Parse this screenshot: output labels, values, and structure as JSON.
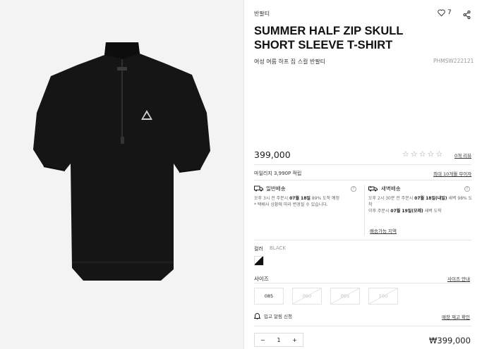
{
  "product": {
    "category": "반팔티",
    "like_count": "7",
    "title_line1": "SUMMER HALF ZIP SKULL",
    "title_line2": "SHORT SLEEVE T-SHIRT",
    "korean_name": "여성 여름 하프 집 스컬 반팔티",
    "code": "PHMSW222121",
    "price": "399,000",
    "reviews_link": "0개 리뷰",
    "rating_stars": 0
  },
  "mileage": {
    "text": "마일리지 3,990P 적립",
    "link": "최대 10개월 무이자"
  },
  "shipping": {
    "standard": {
      "label": "일반배송",
      "line1_pre": "오후 3시 전 주문시 ",
      "line1_date": "07월 18일",
      "line1_post": " 89% 도착 예정",
      "line2": "* 택배사 상황에 따라 변경될 수 있습니다."
    },
    "dawn": {
      "label": "새벽배송",
      "line1_pre": "오후 2시 30분 전 주문시 ",
      "line1_date": "07월 18일(내일)",
      "line1_post": " 새벽 98% 도착",
      "line2_pre": "이후 주문시 ",
      "line2_date": "07월 19일(모레)",
      "line2_post": " 새벽 도착",
      "link": "배송가능 지역"
    }
  },
  "color": {
    "label": "컬러",
    "value": "BLACK"
  },
  "size": {
    "label": "사이즈",
    "guide_link": "사이즈 안내",
    "options": [
      {
        "label": "085",
        "available": true
      },
      {
        "label": "090",
        "available": false
      },
      {
        "label": "095",
        "available": false
      },
      {
        "label": "100",
        "available": false
      }
    ]
  },
  "notify": {
    "label": "입고 알림 신청",
    "stock_link": "매장 재고 확인"
  },
  "order": {
    "quantity": "1",
    "minus": "−",
    "plus": "+",
    "total": "₩399,000"
  },
  "colors": {
    "shirt": "#151515",
    "background_left": "#f3f3f3",
    "text": "#222222"
  }
}
